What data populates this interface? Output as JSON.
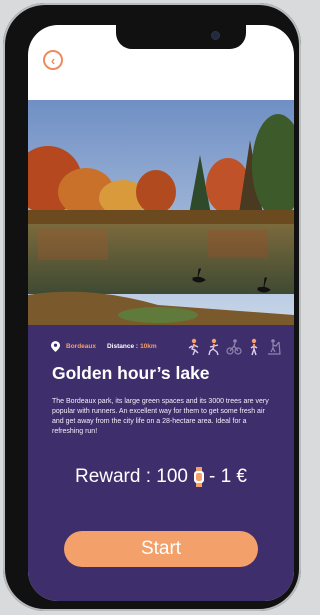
{
  "park": {
    "location": "Bordeaux",
    "distance_label": "Distance :",
    "distance_value": "10km",
    "title": "Golden hour’s lake",
    "description": "The Bordeaux park, its large green spaces and its 3000 trees are very popular with runners. An excellent way for them to get some fresh air and get away from the city life on a 28-hectare area. Ideal for a refreshing run!",
    "activities": [
      {
        "icon": "runner-icon",
        "active": true
      },
      {
        "icon": "runner-icon",
        "active": true
      },
      {
        "icon": "cyclist-icon",
        "active": false
      },
      {
        "icon": "walker-icon",
        "active": true
      },
      {
        "icon": "treadmill-icon",
        "active": false
      }
    ]
  },
  "reward": {
    "prefix": "Reward : 100",
    "suffix": "- 1 €"
  },
  "actions": {
    "start_label": "Start",
    "back_icon": "back-arrow-icon"
  },
  "colors": {
    "accent": "#f4a06a",
    "panel": "#3f2e6c",
    "back": "#f08a5c"
  }
}
